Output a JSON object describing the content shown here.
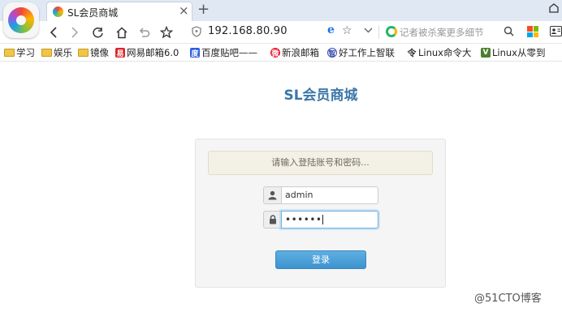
{
  "tab": {
    "title": "SL会员商城",
    "close_label": "×",
    "new_tab_label": "+"
  },
  "address": {
    "url": "192.168.80.90",
    "engine_badge": "e",
    "star": "☆"
  },
  "search": {
    "placeholder": "记者被杀案更多细节"
  },
  "bookmarks": [
    {
      "label": "学习",
      "icon": "folder-icon"
    },
    {
      "label": "娱乐",
      "icon": "folder-icon"
    },
    {
      "label": "镜像",
      "icon": "folder-icon"
    },
    {
      "label": "网易邮箱6.0",
      "icon": "netease-icon"
    },
    {
      "label": "百度贴吧——",
      "icon": "baidu-paw-icon"
    },
    {
      "label": "新浪邮箱",
      "icon": "sina-weibo-icon"
    },
    {
      "label": "好工作上智联",
      "icon": "zhaopin-icon"
    },
    {
      "label": "Linux命令大",
      "icon": "command-icon"
    },
    {
      "label": "Linux从零到",
      "icon": "v-badge-icon"
    }
  ],
  "page": {
    "title": "SL会员商城",
    "alert": "请输入登陆账号和密码...",
    "username": "admin",
    "password_mask": "••••••",
    "login_button": "登录"
  },
  "watermark": "@51CTO博客",
  "colors": {
    "title_blue": "#3a76a8",
    "button_blue": "#3d93cf",
    "alert_bg": "#f3f0e6",
    "titlebar_bg": "#dfe8f3"
  }
}
